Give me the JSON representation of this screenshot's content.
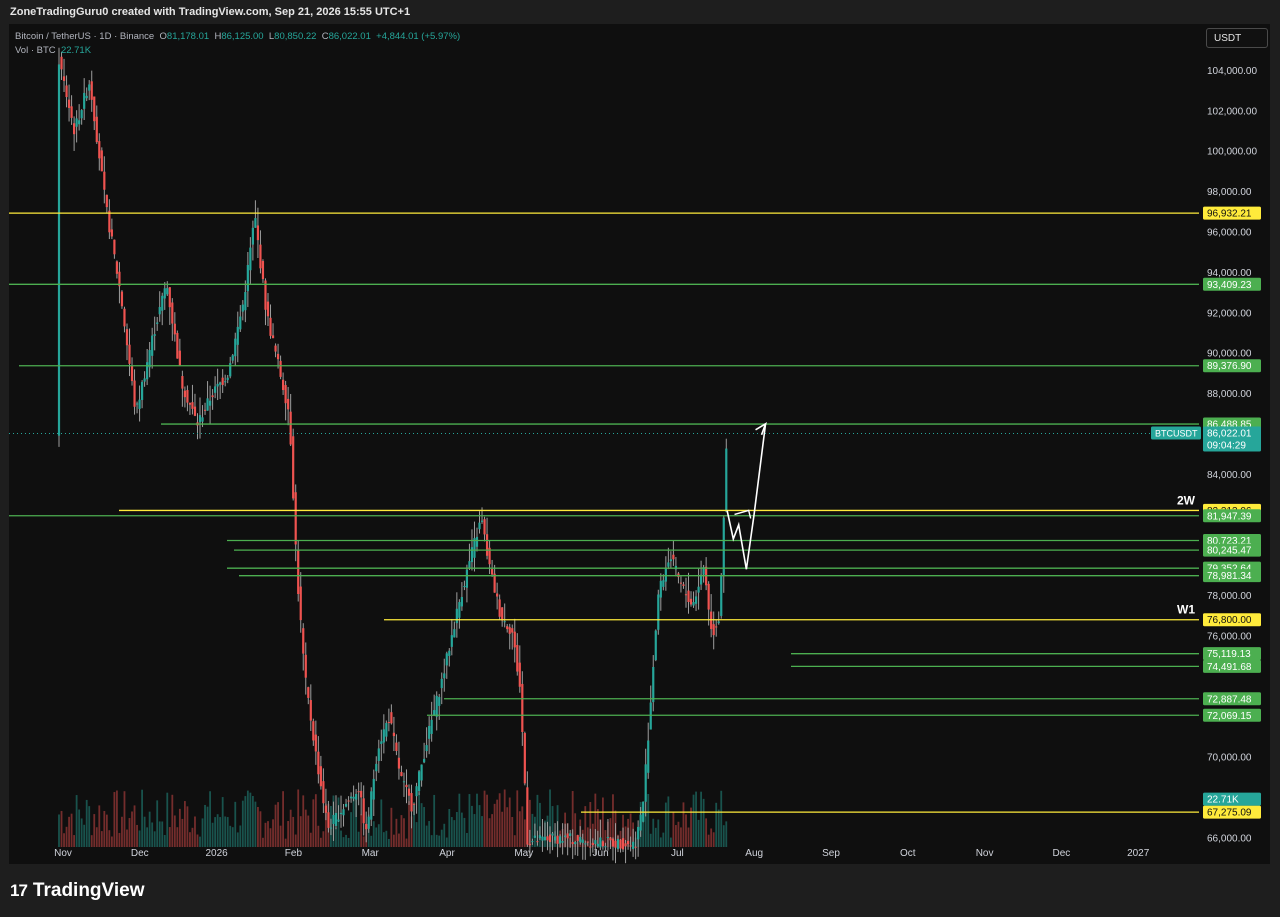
{
  "header": {
    "credit": "ZoneTradingGuru0 created with TradingView.com, Sep 21, 2026 15:55 UTC+1"
  },
  "legend": {
    "symbol": "Bitcoin / TetherUS · 1D · Binance",
    "open_label": "O",
    "open": "81,178.01",
    "high_label": "H",
    "high": "86,125.00",
    "low_label": "L",
    "low": "80,850.22",
    "close_label": "C",
    "close": "86,022.01",
    "change": "+4,844.01 (+5.97%)",
    "volume_label": "Vol · BTC",
    "volume": "22.71K"
  },
  "currency_button": "USDT",
  "footer": {
    "brand_mark": "17",
    "brand": "TradingView"
  },
  "colors": {
    "up": "#26a69a",
    "down": "#ef5350",
    "level_green": "#4caf50",
    "level_yellow": "#ffeb3b",
    "background": "#0f0f0f"
  },
  "chart_data": {
    "type": "candlestick",
    "symbol": "BTCUSDT",
    "interval": "1D",
    "ylim": [
      65300,
      106000
    ],
    "y_ticks": [
      "104,000.00",
      "102,000.00",
      "100,000.00",
      "98,000.00",
      "96,000.00",
      "94,000.00",
      "92,000.00",
      "90,000.00",
      "88,000.00",
      "84,000.00",
      "78,000.00",
      "76,000.00",
      "70,000.00",
      "68,000.00",
      "66,000.00"
    ],
    "x_ticks": [
      "Nov",
      "Dec",
      "2026",
      "Feb",
      "Mar",
      "Apr",
      "May",
      "Jun",
      "Jul",
      "Aug",
      "Sep",
      "Oct",
      "Nov",
      "Dec",
      "2027"
    ],
    "levels": [
      {
        "label": "96,932.21",
        "value": 96932.21,
        "color": "yellow"
      },
      {
        "label": "93,409.23",
        "value": 93409.23,
        "color": "green"
      },
      {
        "label": "89,376.90",
        "value": 89376.9,
        "color": "green"
      },
      {
        "label": "86,488.85",
        "value": 86488.85,
        "color": "green"
      },
      {
        "label": "82,213.06",
        "value": 82213.06,
        "color": "yellow"
      },
      {
        "label": "81,947.39",
        "value": 81947.39,
        "color": "green"
      },
      {
        "label": "80,723.21",
        "value": 80723.21,
        "color": "green"
      },
      {
        "label": "80,245.47",
        "value": 80245.47,
        "color": "green"
      },
      {
        "label": "79,352.64",
        "value": 79352.64,
        "color": "green"
      },
      {
        "label": "78,981.34",
        "value": 78981.34,
        "color": "green"
      },
      {
        "label": "76,800.00",
        "value": 76800.0,
        "color": "yellow"
      },
      {
        "label": "75,119.13",
        "value": 75119.13,
        "color": "green"
      },
      {
        "label": "74,491.68",
        "value": 74491.68,
        "color": "green"
      },
      {
        "label": "72,887.48",
        "value": 72887.48,
        "color": "green"
      },
      {
        "label": "72,069.15",
        "value": 72069.15,
        "color": "green"
      },
      {
        "label": "67,275.09",
        "value": 67275.09,
        "color": "yellow"
      }
    ],
    "level_tags": [
      {
        "text": "2W",
        "value": 82213.06
      },
      {
        "text": "W1",
        "value": 76800.0
      }
    ],
    "last_price": {
      "symbol": "BTCUSDT",
      "price": "86,022.01",
      "countdown": "09:04:29",
      "value": 86022.01
    },
    "volume_label": "22.71K",
    "price_path": [
      {
        "month": 0.0,
        "price": 104500
      },
      {
        "month": 0.2,
        "price": 101000
      },
      {
        "month": 0.4,
        "price": 103500
      },
      {
        "month": 0.6,
        "price": 97500
      },
      {
        "month": 0.8,
        "price": 93000
      },
      {
        "month": 1.0,
        "price": 87000
      },
      {
        "month": 1.2,
        "price": 90500
      },
      {
        "month": 1.4,
        "price": 93500
      },
      {
        "month": 1.6,
        "price": 88500
      },
      {
        "month": 1.8,
        "price": 86500
      },
      {
        "month": 2.0,
        "price": 88000
      },
      {
        "month": 2.2,
        "price": 89000
      },
      {
        "month": 2.4,
        "price": 92500
      },
      {
        "month": 2.55,
        "price": 96800
      },
      {
        "month": 2.7,
        "price": 92000
      },
      {
        "month": 2.85,
        "price": 89500
      },
      {
        "month": 3.0,
        "price": 87000
      },
      {
        "month": 3.1,
        "price": 79000
      },
      {
        "month": 3.2,
        "price": 74000
      },
      {
        "month": 3.35,
        "price": 70000
      },
      {
        "month": 3.5,
        "price": 66500
      },
      {
        "month": 3.7,
        "price": 67500
      },
      {
        "month": 3.9,
        "price": 68500
      },
      {
        "month": 4.0,
        "price": 66200
      },
      {
        "month": 4.15,
        "price": 70500
      },
      {
        "month": 4.3,
        "price": 72000
      },
      {
        "month": 4.45,
        "price": 69000
      },
      {
        "month": 4.6,
        "price": 67500
      },
      {
        "month": 4.8,
        "price": 71000
      },
      {
        "month": 5.0,
        "price": 74000
      },
      {
        "month": 5.2,
        "price": 77500
      },
      {
        "month": 5.4,
        "price": 80500
      },
      {
        "month": 5.5,
        "price": 81800
      },
      {
        "month": 5.6,
        "price": 79500
      },
      {
        "month": 5.75,
        "price": 77000
      },
      {
        "month": 5.9,
        "price": 76200
      },
      {
        "month": 6.0,
        "price": 73500
      },
      {
        "month": 6.05,
        "price": 70000
      },
      {
        "month": 6.1,
        "price": 65800
      },
      {
        "month": 6.5,
        "price": 66000
      },
      {
        "month": 7.0,
        "price": 65800
      },
      {
        "month": 7.5,
        "price": 65700
      },
      {
        "month": 7.6,
        "price": 67500
      },
      {
        "month": 7.7,
        "price": 72500
      },
      {
        "month": 7.8,
        "price": 78000
      },
      {
        "month": 7.95,
        "price": 80000
      },
      {
        "month": 8.1,
        "price": 78500
      },
      {
        "month": 8.25,
        "price": 77500
      },
      {
        "month": 8.4,
        "price": 79500
      },
      {
        "month": 8.5,
        "price": 76000
      },
      {
        "month": 8.6,
        "price": 77000
      },
      {
        "month": 8.65,
        "price": 81500
      },
      {
        "month": 8.7,
        "price": 86022
      }
    ],
    "projection_path": [
      {
        "month": 8.7,
        "price": 82200
      },
      {
        "month": 8.78,
        "price": 80800
      },
      {
        "month": 8.85,
        "price": 81500
      },
      {
        "month": 8.95,
        "price": 79300
      },
      {
        "month": 9.05,
        "price": 82000
      },
      {
        "month": 9.2,
        "price": 86500
      }
    ]
  }
}
